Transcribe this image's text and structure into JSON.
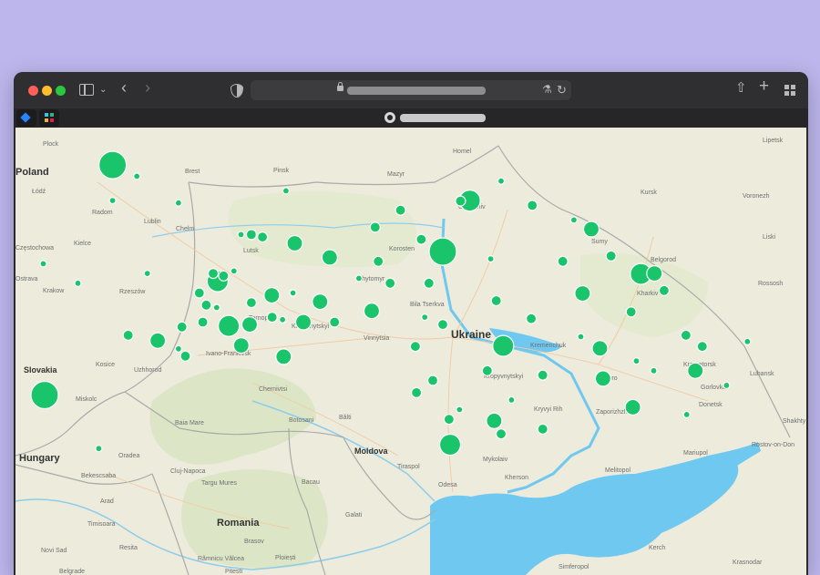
{
  "colors": {
    "desktop_bg": "#bdb6ec",
    "marker": "#19c46a",
    "marker_stroke": "#ffffff",
    "land": "#ecebdc",
    "forest": "#d9e6c1",
    "water": "#6fc8ef",
    "border": "#a9a9a9",
    "road": "#f2c9a0"
  },
  "browser": {
    "icons": [
      "sidebar-icon",
      "chevron-down-icon",
      "back-icon",
      "forward-icon",
      "shield-icon",
      "lock-icon",
      "translate-icon",
      "reload-icon",
      "share-icon",
      "plus-icon",
      "tab-grid-icon"
    ],
    "favorites": [
      "jira-icon",
      "app-icon"
    ]
  },
  "map": {
    "countries": [
      "Poland",
      "Hungary",
      "Slovakia",
      "Romania",
      "Moldova",
      "Ukraine"
    ],
    "cities": [
      "Plock",
      "Brest",
      "Pinsk",
      "Homel",
      "Mazyr",
      "Lipetsk",
      "Kursk",
      "Voronezh",
      "Radom",
      "Lublin",
      "Chelm",
      "Kielce",
      "Łódź",
      "Chernihiv",
      "Lutsk",
      "Sumy",
      "Liski",
      "Belgorod",
      "Rossosh",
      "Rzeszów",
      "Krakow",
      "Zhytomyr",
      "Bila Tserkva",
      "Kharkiv",
      "Khmelnytskyi",
      "Ternopil",
      "Vinnytsia",
      "Kremenchuk",
      "Ivano-Frankivsk",
      "Kramatorsk",
      "Luhansk",
      "Gorlovka",
      "Donetsk",
      "Kropyvnytskyi",
      "Kryvyi Rih",
      "Zaporizhzhia",
      "Kosice",
      "Uzhhorod",
      "Miskolc",
      "Chernivtsi",
      "Botosani",
      "Bălti",
      "Baia Mare",
      "Oradea",
      "Shakhty",
      "Rostov-on-Don",
      "Mariupol",
      "Mykolaiv",
      "Kherson",
      "Tiraspol",
      "Odesa",
      "Bekescsaba",
      "Cluj-Napoca",
      "Targu Mures",
      "Bacau",
      "Galati",
      "Arad",
      "Timisoara",
      "Brasov",
      "Melitopol",
      "Novi Sad",
      "Resita",
      "Râmnicu Vâlcea",
      "Ploiești",
      "Belgrade",
      "Pitesti",
      "Kerch",
      "Simferopol",
      "Krasnodar",
      "Częstochowa",
      "Ostrava",
      "Korosten",
      "Dnipro"
    ],
    "markers": [
      {
        "lng": 21.0,
        "lat": 52.23,
        "size": 5
      },
      {
        "lng": 19.04,
        "lat": 47.5,
        "size": 5
      },
      {
        "lng": 30.52,
        "lat": 50.45,
        "size": 5
      },
      {
        "lng": 31.3,
        "lat": 51.5,
        "size": 4
      },
      {
        "lng": 24.03,
        "lat": 49.84,
        "size": 4
      },
      {
        "lng": 30.73,
        "lat": 46.48,
        "size": 4
      },
      {
        "lng": 32.26,
        "lat": 48.51,
        "size": 4
      },
      {
        "lng": 36.23,
        "lat": 49.99,
        "size": 4
      },
      {
        "lng": 35.14,
        "lat": 47.84,
        "size": 3
      },
      {
        "lng": 34.8,
        "lat": 50.91,
        "size": 3
      },
      {
        "lng": 24.35,
        "lat": 48.92,
        "size": 4
      },
      {
        "lng": 28.47,
        "lat": 49.23,
        "size": 3
      },
      {
        "lng": 26.98,
        "lat": 49.42,
        "size": 3
      },
      {
        "lng": 25.59,
        "lat": 49.55,
        "size": 3
      },
      {
        "lng": 28.66,
        "lat": 50.25,
        "size": 2
      },
      {
        "lng": 31.03,
        "lat": 51.49,
        "size": 2
      },
      {
        "lng": 32.06,
        "lat": 49.44,
        "size": 2
      },
      {
        "lng": 35.05,
        "lat": 48.46,
        "size": 3
      },
      {
        "lng": 36.62,
        "lat": 50.0,
        "size": 3
      },
      {
        "lng": 37.8,
        "lat": 48.0,
        "size": 3
      },
      {
        "lng": 32.0,
        "lat": 46.97,
        "size": 3
      },
      {
        "lng": 33.4,
        "lat": 47.91,
        "size": 2
      },
      {
        "lng": 25.93,
        "lat": 48.29,
        "size": 3
      },
      {
        "lng": 22.3,
        "lat": 48.62,
        "size": 3
      },
      {
        "lng": 24.71,
        "lat": 48.52,
        "size": 3
      },
      {
        "lng": 26.25,
        "lat": 50.62,
        "size": 3
      },
      {
        "lng": 25.32,
        "lat": 50.75,
        "size": 2
      },
      {
        "lng": 27.26,
        "lat": 50.33,
        "size": 3
      },
      {
        "lng": 29.0,
        "lat": 49.8,
        "size": 2
      },
      {
        "lng": 30.12,
        "lat": 49.8,
        "size": 2
      },
      {
        "lng": 30.52,
        "lat": 48.95,
        "size": 2
      },
      {
        "lng": 29.73,
        "lat": 48.5,
        "size": 2
      },
      {
        "lng": 30.23,
        "lat": 47.8,
        "size": 2
      },
      {
        "lng": 33.07,
        "lat": 49.07,
        "size": 2
      },
      {
        "lng": 34.55,
        "lat": 49.59,
        "size": 3
      },
      {
        "lng": 35.95,
        "lat": 49.21,
        "size": 2
      },
      {
        "lng": 35.37,
        "lat": 50.36,
        "size": 2
      },
      {
        "lng": 33.98,
        "lat": 50.25,
        "size": 2
      },
      {
        "lng": 36.9,
        "lat": 49.65,
        "size": 2
      },
      {
        "lng": 37.53,
        "lat": 48.73,
        "size": 2
      },
      {
        "lng": 38.0,
        "lat": 48.5,
        "size": 2
      },
      {
        "lng": 36.0,
        "lat": 47.25,
        "size": 3
      },
      {
        "lng": 33.4,
        "lat": 46.8,
        "size": 2
      },
      {
        "lng": 32.2,
        "lat": 46.7,
        "size": 2
      },
      {
        "lng": 29.76,
        "lat": 47.55,
        "size": 2
      },
      {
        "lng": 30.7,
        "lat": 47.0,
        "size": 2
      },
      {
        "lng": 31.8,
        "lat": 48.0,
        "size": 2
      },
      {
        "lng": 28.57,
        "lat": 50.95,
        "size": 2
      },
      {
        "lng": 29.9,
        "lat": 50.7,
        "size": 2
      },
      {
        "lng": 29.3,
        "lat": 51.3,
        "size": 2
      },
      {
        "lng": 33.1,
        "lat": 51.4,
        "size": 2
      },
      {
        "lng": 34.3,
        "lat": 51.1,
        "size": 1
      },
      {
        "lng": 25.0,
        "lat": 50.8,
        "size": 2
      },
      {
        "lng": 24.7,
        "lat": 50.8,
        "size": 1
      },
      {
        "lng": 23.9,
        "lat": 50.0,
        "size": 2
      },
      {
        "lng": 23.5,
        "lat": 49.6,
        "size": 2
      },
      {
        "lng": 23.7,
        "lat": 49.35,
        "size": 2
      },
      {
        "lng": 23.6,
        "lat": 49.0,
        "size": 2
      },
      {
        "lng": 24.2,
        "lat": 49.95,
        "size": 2
      },
      {
        "lng": 25.0,
        "lat": 49.4,
        "size": 2
      },
      {
        "lng": 24.5,
        "lat": 50.05,
        "size": 1
      },
      {
        "lng": 24.0,
        "lat": 49.3,
        "size": 1
      },
      {
        "lng": 23.0,
        "lat": 48.9,
        "size": 2
      },
      {
        "lng": 22.9,
        "lat": 48.45,
        "size": 1
      },
      {
        "lng": 23.1,
        "lat": 48.3,
        "size": 2
      },
      {
        "lng": 25.9,
        "lat": 49.05,
        "size": 1
      },
      {
        "lng": 26.5,
        "lat": 49.0,
        "size": 3
      },
      {
        "lng": 27.4,
        "lat": 49.0,
        "size": 2
      },
      {
        "lng": 25.6,
        "lat": 49.1,
        "size": 2
      },
      {
        "lng": 24.95,
        "lat": 48.95,
        "size": 3
      },
      {
        "lng": 26.2,
        "lat": 49.6,
        "size": 1
      },
      {
        "lng": 21.45,
        "lat": 48.73,
        "size": 2
      },
      {
        "lng": 21.0,
        "lat": 51.5,
        "size": 1
      },
      {
        "lng": 21.7,
        "lat": 52.0,
        "size": 1
      },
      {
        "lng": 22.9,
        "lat": 51.45,
        "size": 1
      },
      {
        "lng": 26.0,
        "lat": 51.7,
        "size": 1
      },
      {
        "lng": 19.0,
        "lat": 50.2,
        "size": 1
      },
      {
        "lng": 20.0,
        "lat": 49.8,
        "size": 1
      },
      {
        "lng": 22.0,
        "lat": 50.0,
        "size": 1
      },
      {
        "lng": 39.3,
        "lat": 48.6,
        "size": 1
      },
      {
        "lng": 38.7,
        "lat": 47.7,
        "size": 1
      },
      {
        "lng": 37.55,
        "lat": 47.1,
        "size": 1
      },
      {
        "lng": 20.6,
        "lat": 46.4,
        "size": 1
      },
      {
        "lng": 34.5,
        "lat": 48.7,
        "size": 1
      },
      {
        "lng": 36.1,
        "lat": 48.2,
        "size": 1
      },
      {
        "lng": 36.6,
        "lat": 48.0,
        "size": 1
      },
      {
        "lng": 31.0,
        "lat": 47.2,
        "size": 1
      },
      {
        "lng": 32.5,
        "lat": 47.4,
        "size": 1
      },
      {
        "lng": 30.0,
        "lat": 49.1,
        "size": 1
      },
      {
        "lng": 28.1,
        "lat": 49.9,
        "size": 1
      },
      {
        "lng": 31.9,
        "lat": 50.3,
        "size": 1
      },
      {
        "lng": 32.2,
        "lat": 51.9,
        "size": 1
      }
    ]
  }
}
